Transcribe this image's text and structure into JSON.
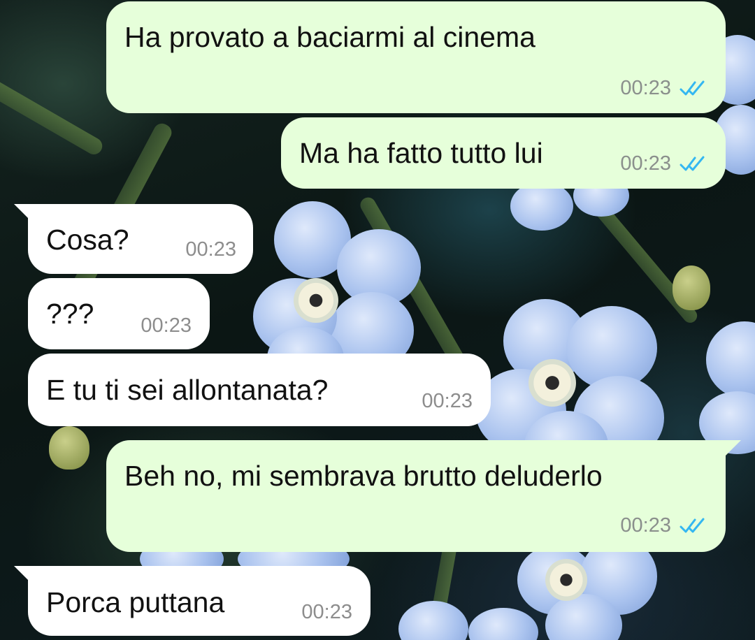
{
  "chat": {
    "messages": [
      {
        "direction": "outgoing",
        "text": "Ha provato a baciarmi al cinema",
        "time": "00:23",
        "status": "read"
      },
      {
        "direction": "outgoing",
        "text": "Ma ha fatto tutto lui",
        "time": "00:23",
        "status": "read"
      },
      {
        "direction": "incoming",
        "text": "Cosa?",
        "time": "00:23"
      },
      {
        "direction": "incoming",
        "text": "???",
        "time": "00:23"
      },
      {
        "direction": "incoming",
        "text": "E tu ti sei allontanata?",
        "time": "00:23"
      },
      {
        "direction": "outgoing",
        "text": "Beh no, mi sembrava brutto deluderlo",
        "time": "00:23",
        "status": "read"
      },
      {
        "direction": "incoming",
        "text": "Porca puttana",
        "time": "00:23"
      }
    ]
  },
  "colors": {
    "outgoing_bubble": "#e6ffda",
    "incoming_bubble": "#ffffff",
    "read_ticks": "#34b7f1",
    "timestamp": "#8a8f8c"
  },
  "icons": {
    "read_receipt": "double-check-icon"
  }
}
